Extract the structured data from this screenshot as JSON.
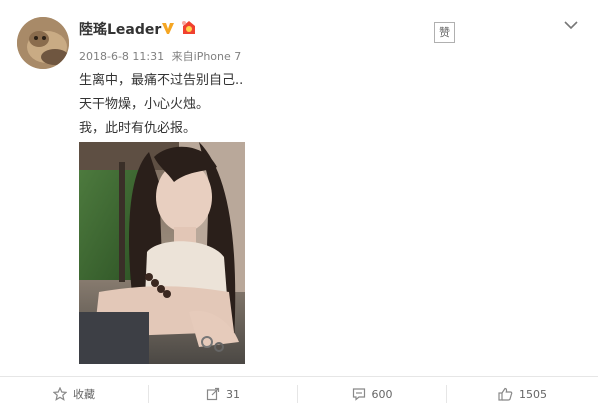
{
  "post": {
    "user": {
      "name": "陸瑤Leader"
    },
    "meta": {
      "time": "2018-6-8 11:31",
      "source_prefix": "来自",
      "source": "iPhone 7"
    },
    "stamp": "赞",
    "lines": [
      "生离中，最痛不过告别自己..",
      "天干物燥，小心火烛。",
      "我，此时有仇必报。"
    ]
  },
  "actions": {
    "favorite": {
      "label": "收藏"
    },
    "repost": {
      "count": "31"
    },
    "comment": {
      "count": "600"
    },
    "like": {
      "count": "1505"
    }
  },
  "colors": {
    "verified": "#f5a623",
    "vip": "#f0412f",
    "text": "#333333",
    "meta": "#808080"
  },
  "icons": [
    "star-icon",
    "repost-icon",
    "comment-icon",
    "thumb-up-icon",
    "chevron-down-icon",
    "verified-icon",
    "vip-icon"
  ]
}
